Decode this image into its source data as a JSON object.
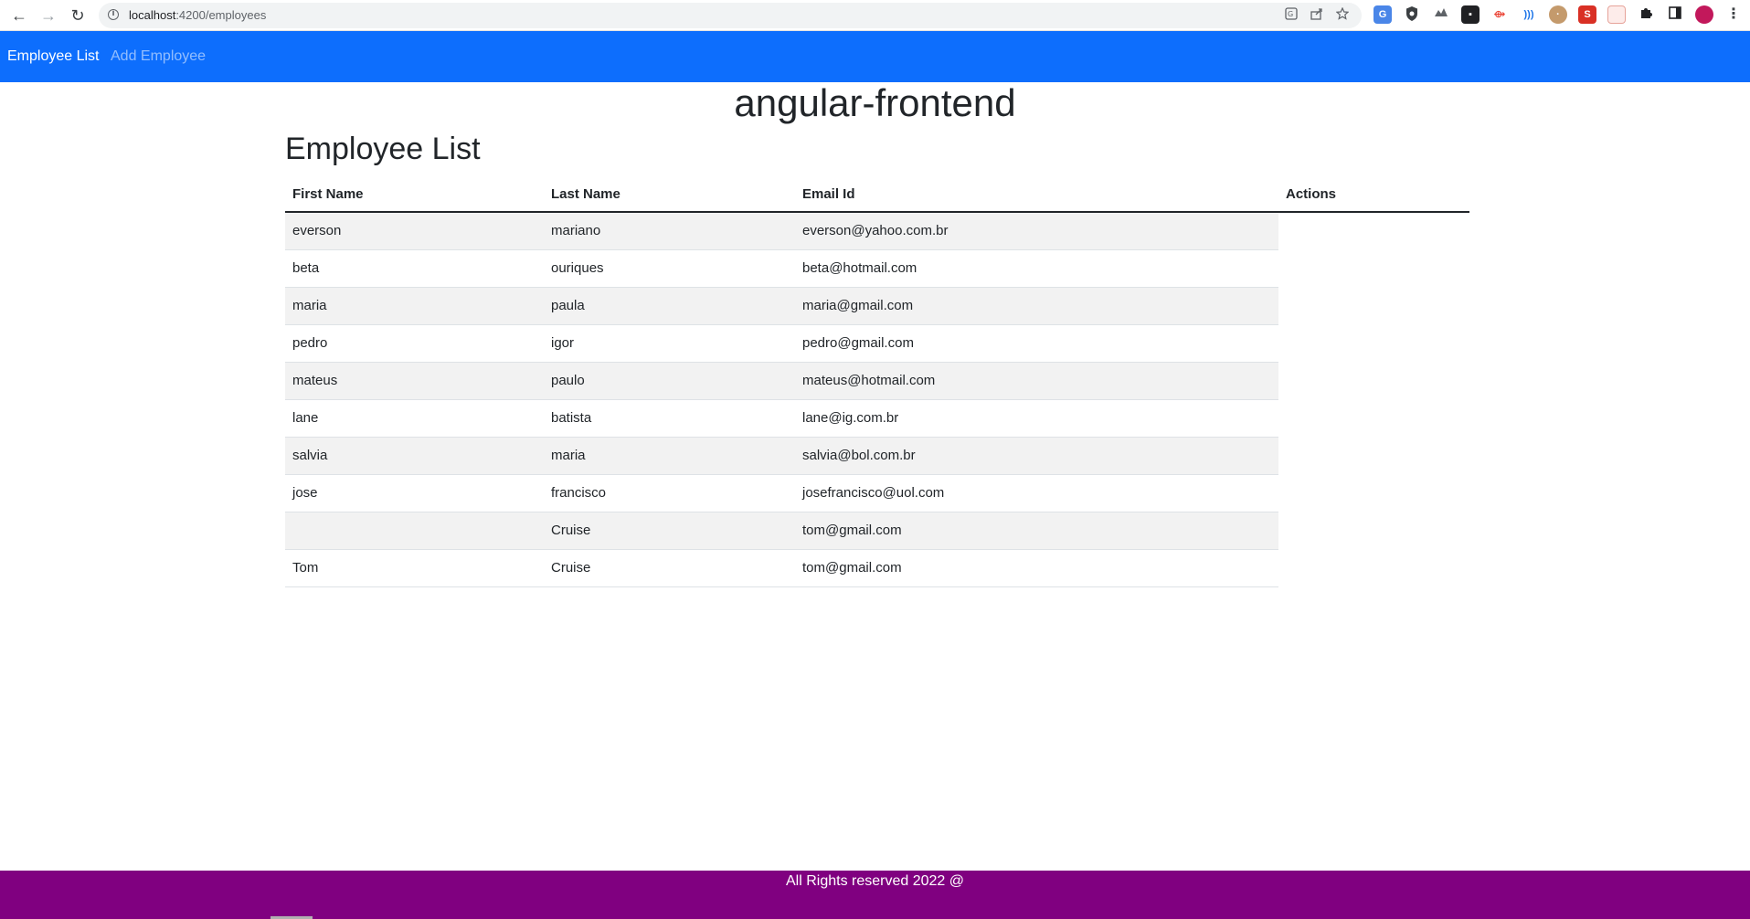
{
  "browser": {
    "url_host": "localhost",
    "url_path": ":4200/employees",
    "info_icon": "i",
    "nav_back_icon": "←",
    "nav_forward_icon": "→",
    "nav_reload_icon": "↻",
    "omnibox_actions": [
      "translate-icon",
      "share-icon",
      "bookmark-star-icon"
    ],
    "extensions": [
      "translate-ext-icon",
      "shield-ext-icon",
      "cloud-ext-icon",
      "tab-ext-icon",
      "arrows-ext-icon",
      "speech-ext-icon",
      "cookie-ext-icon",
      "s-ext-icon",
      "calendar-ext-icon",
      "puzzle-icon",
      "sidepanel-icon",
      "profile-avatar",
      "menu-dots-icon"
    ]
  },
  "navbar": {
    "links": [
      {
        "label": "Employee List",
        "active": true
      },
      {
        "label": "Add Employee",
        "active": false
      }
    ],
    "color": "#0d6efd"
  },
  "app_title": "angular-frontend",
  "page_heading": "Employee List",
  "table": {
    "headers": [
      "First Name",
      "Last Name",
      "Email Id",
      "Actions"
    ],
    "rows": [
      {
        "first": "everson",
        "last": "mariano",
        "email": "everson@yahoo.com.br"
      },
      {
        "first": "beta",
        "last": "ouriques",
        "email": "beta@hotmail.com"
      },
      {
        "first": "maria",
        "last": "paula",
        "email": "maria@gmail.com"
      },
      {
        "first": "pedro",
        "last": "igor",
        "email": "pedro@gmail.com"
      },
      {
        "first": "mateus",
        "last": "paulo",
        "email": "mateus@hotmail.com"
      },
      {
        "first": "lane",
        "last": "batista",
        "email": "lane@ig.com.br"
      },
      {
        "first": "salvia",
        "last": "maria",
        "email": "salvia@bol.com.br"
      },
      {
        "first": "jose",
        "last": "francisco",
        "email": "josefrancisco@uol.com"
      },
      {
        "first": "",
        "last": "Cruise",
        "email": "tom@gmail.com"
      },
      {
        "first": "Tom",
        "last": "Cruise",
        "email": "tom@gmail.com"
      }
    ]
  },
  "footer": {
    "text": "All Rights reserved 2022 @",
    "color": "#800080"
  }
}
